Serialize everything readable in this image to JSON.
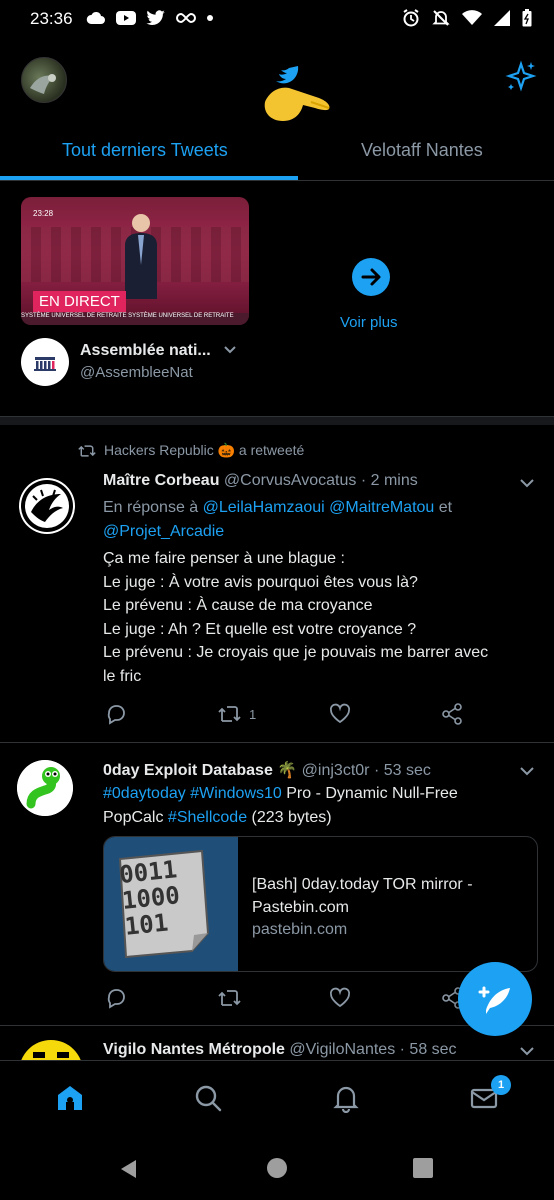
{
  "status_bar": {
    "time": "23:36"
  },
  "header": {
    "logo_alt": "Twitter"
  },
  "tabs": [
    {
      "label": "Tout derniers Tweets",
      "active": true
    },
    {
      "label": "Velotaff Nantes",
      "active": false
    }
  ],
  "live_card": {
    "video_time": "23:28",
    "badge": "EN DIRECT",
    "caption": "SYSTÈME UNIVERSEL DE RETRAITE     SYSTÈME UNIVERSEL DE RETRAITE",
    "see_more": "Voir plus",
    "account_name": "Assemblée nati...",
    "account_handle": "@AssembleeNat"
  },
  "tweets": [
    {
      "retweet_by": "Hackers Republic 🎃 a retweeté",
      "name": "Maître Corbeau",
      "handle": "@CorvusAvocatus",
      "time": "· 2 mins",
      "reply_prefix": "En réponse à ",
      "reply_to_1": "@LeilaHamzaoui",
      "reply_to_2": "@MaitreMatou",
      "reply_and": " et",
      "reply_to_3": "@Projet_Arcadie",
      "lines": [
        "Ça me faire penser à une blague :",
        "Le juge : À votre avis pourquoi êtes vous là?",
        "Le prévenu : À cause de ma croyance",
        "Le juge : Ah ? Et quelle est votre croyance ?",
        "Le prévenu : Je croyais que je pouvais me barrer avec",
        "le fric"
      ],
      "retweets": "1"
    },
    {
      "name": "0day Exploit Database 🌴",
      "handle": "@inj3ct0r",
      "time": "· 53 sec",
      "hashtag1": "#0daytoday",
      "hashtag2": "#Windows10",
      "text1": " Pro - Dynamic Null-Free",
      "text2": "PopCalc ",
      "hashtag3": "#Shellcode",
      "text3": " (223 bytes)",
      "card_title": "[Bash] 0day.today TOR mirror - Pastebin.com",
      "card_domain": "pastebin.com",
      "card_image_text": [
        "0011",
        "1000",
        "101"
      ]
    },
    {
      "name": "Vigilo Nantes Métropole",
      "handle": "@VigiloNantes",
      "time": "· 58 sec"
    }
  ],
  "bottom_nav": {
    "messages_badge": "1"
  },
  "colors": {
    "accent": "#1da1f2",
    "background": "#000000",
    "muted": "#8b98a5",
    "live": "#e0245e"
  }
}
